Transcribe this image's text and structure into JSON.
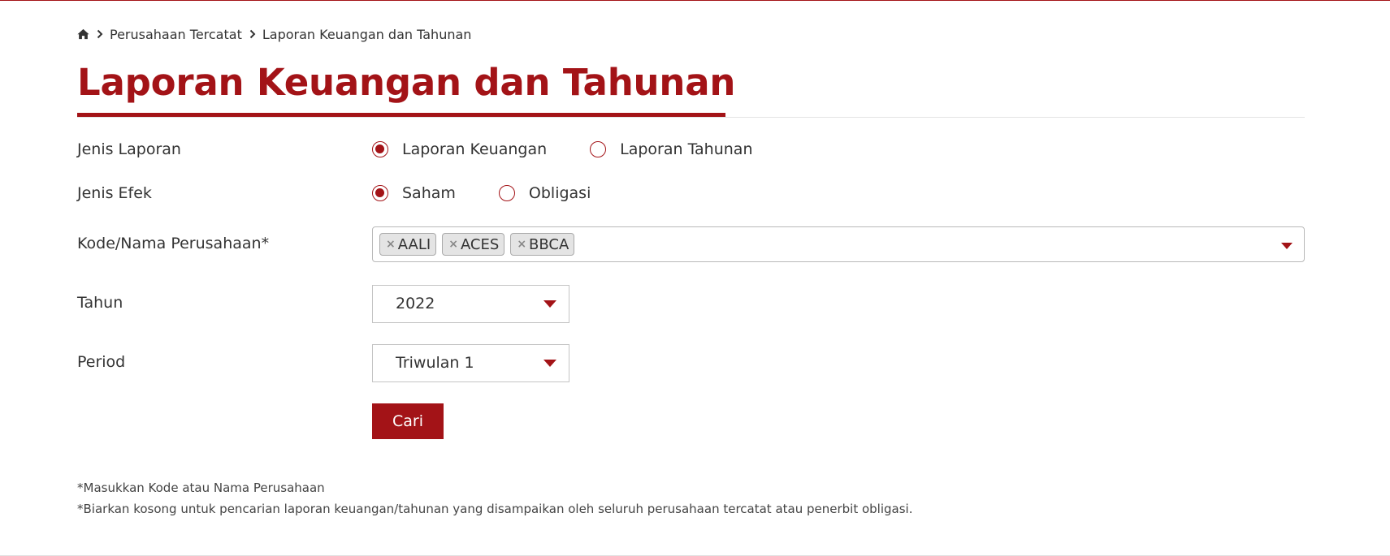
{
  "breadcrumb": {
    "home_icon": "home-icon",
    "items": [
      "Perusahaan Tercatat",
      "Laporan Keuangan dan Tahunan"
    ]
  },
  "page_title": "Laporan Keuangan dan Tahunan",
  "form": {
    "jenis_laporan": {
      "label": "Jenis Laporan",
      "options": [
        "Laporan Keuangan",
        "Laporan Tahunan"
      ],
      "selected": "Laporan Keuangan"
    },
    "jenis_efek": {
      "label": "Jenis Efek",
      "options": [
        "Saham",
        "Obligasi"
      ],
      "selected": "Saham"
    },
    "perusahaan": {
      "label": "Kode/Nama Perusahaan*",
      "tags": [
        "AALI",
        "ACES",
        "BBCA"
      ],
      "tag_remove": "×"
    },
    "tahun": {
      "label": "Tahun",
      "value": "2022"
    },
    "period": {
      "label": "Period",
      "value": "Triwulan 1"
    },
    "submit_label": "Cari"
  },
  "notes": [
    "*Masukkan Kode atau Nama Perusahaan",
    "*Biarkan kosong untuk pencarian laporan keuangan/tahunan yang disampaikan oleh seluruh perusahaan tercatat atau penerbit obligasi."
  ],
  "colors": {
    "accent": "#a31317",
    "text": "#333333",
    "border": "#c4c4c4"
  }
}
